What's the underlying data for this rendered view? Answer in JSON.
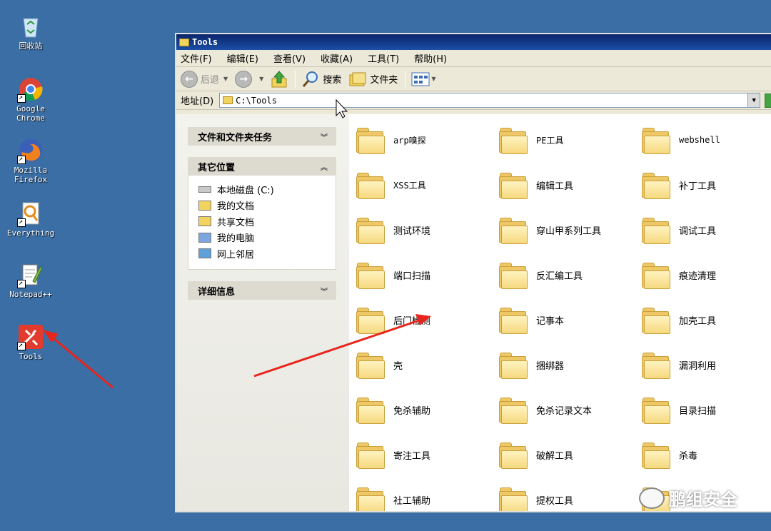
{
  "desktop": {
    "icons": [
      {
        "label": "回收站"
      },
      {
        "label": "Google\nChrome"
      },
      {
        "label": "Mozilla\nFirefox"
      },
      {
        "label": "Everything"
      },
      {
        "label": "Notepad++"
      },
      {
        "label": "Tools"
      }
    ]
  },
  "window": {
    "title": "Tools",
    "menu": [
      "文件(F)",
      "编辑(E)",
      "查看(V)",
      "收藏(A)",
      "工具(T)",
      "帮助(H)"
    ],
    "toolbar": {
      "back": "后退",
      "search": "搜索",
      "folders": "文件夹"
    },
    "address": {
      "label": "地址(D)",
      "path": "C:\\Tools"
    }
  },
  "taskpane": {
    "file_tasks": "文件和文件夹任务",
    "other_places": {
      "title": "其它位置",
      "items": [
        "本地磁盘 (C:)",
        "我的文档",
        "共享文档",
        "我的电脑",
        "网上邻居"
      ]
    },
    "details": "详细信息"
  },
  "folders": [
    "arp嗅探",
    "PE工具",
    "webshell",
    "XSS工具",
    "编辑工具",
    "补丁工具",
    "测试环境",
    "穿山甲系列工具",
    "调试工具",
    "端口扫描",
    "反汇编工具",
    "痕迹清理",
    "后门检测",
    "记事本",
    "加壳工具",
    "壳",
    "捆绑器",
    "漏洞利用",
    "免杀辅助",
    "免杀记录文本",
    "目录扫描",
    "寄注工具",
    "破解工具",
    "杀毒",
    "社工辅助",
    "提权工具",
    ""
  ],
  "watermark": "鹏组安全",
  "colors": {
    "desktop": "#3a6ea5",
    "titlebar": "#0a246a",
    "folder": "#eec766",
    "arrow": "#e8251c"
  }
}
